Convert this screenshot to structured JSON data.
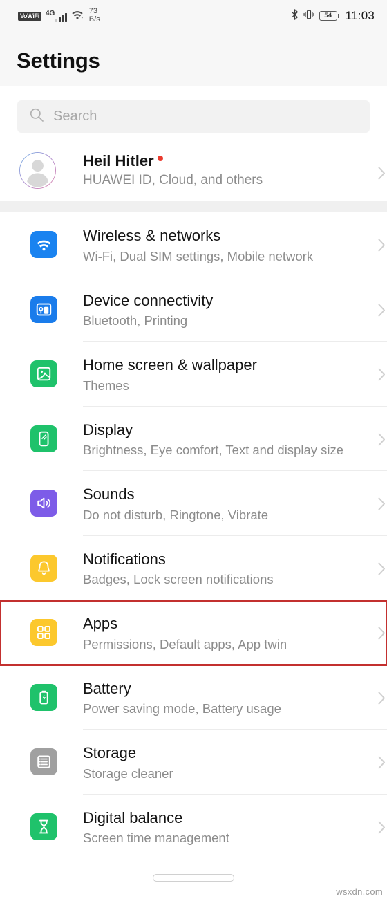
{
  "status_bar": {
    "vowifi_label": "VoWiFi",
    "network_type": "4G",
    "data_rate_value": "73",
    "data_rate_unit": "B/s",
    "battery_level": "54",
    "time": "11:03",
    "icons": [
      "vowifi-badge",
      "signal-bars-icon",
      "wifi-icon",
      "bluetooth-icon",
      "vibrate-icon",
      "battery-icon"
    ]
  },
  "header": {
    "title": "Settings"
  },
  "search": {
    "placeholder": "Search",
    "icon": "search-icon"
  },
  "account": {
    "name": "Heil Hitler",
    "subtitle": "HUAWEI ID, Cloud, and others",
    "badge": "red-dot",
    "avatar_icon": "person-avatar-icon"
  },
  "settings_list": [
    {
      "title": "Wireless & networks",
      "subtitle": "Wi-Fi, Dual SIM settings, Mobile network",
      "icon": "wifi-icon",
      "icon_color": "#1a83f0",
      "highlighted": false
    },
    {
      "title": "Device connectivity",
      "subtitle": "Bluetooth, Printing",
      "icon": "device-connectivity-icon",
      "icon_color": "#1a7ceb",
      "highlighted": false
    },
    {
      "title": "Home screen & wallpaper",
      "subtitle": "Themes",
      "icon": "wallpaper-image-icon",
      "icon_color": "#1fc26b",
      "highlighted": false
    },
    {
      "title": "Display",
      "subtitle": "Brightness, Eye comfort, Text and display size",
      "icon": "display-phone-icon",
      "icon_color": "#1fc26b",
      "highlighted": false
    },
    {
      "title": "Sounds",
      "subtitle": "Do not disturb, Ringtone, Vibrate",
      "icon": "speaker-volume-icon",
      "icon_color": "#7d5ce8",
      "highlighted": false
    },
    {
      "title": "Notifications",
      "subtitle": "Badges, Lock screen notifications",
      "icon": "bell-icon",
      "icon_color": "#fcc82d",
      "highlighted": false
    },
    {
      "title": "Apps",
      "subtitle": "Permissions, Default apps, App twin",
      "icon": "apps-grid-icon",
      "icon_color": "#fcc82d",
      "highlighted": true
    },
    {
      "title": "Battery",
      "subtitle": "Power saving mode, Battery usage",
      "icon": "battery-bolt-icon",
      "icon_color": "#1fc26b",
      "highlighted": false
    },
    {
      "title": "Storage",
      "subtitle": "Storage cleaner",
      "icon": "storage-list-icon",
      "icon_color": "#a0a0a0",
      "highlighted": false
    },
    {
      "title": "Digital balance",
      "subtitle": "Screen time management",
      "icon": "hourglass-icon",
      "icon_color": "#1fc26b",
      "highlighted": false
    }
  ],
  "highlight": {
    "color": "#c3302f"
  },
  "bottom": {
    "home_indicator": "home-gesture-pill",
    "watermark": "wsxdn.com"
  }
}
